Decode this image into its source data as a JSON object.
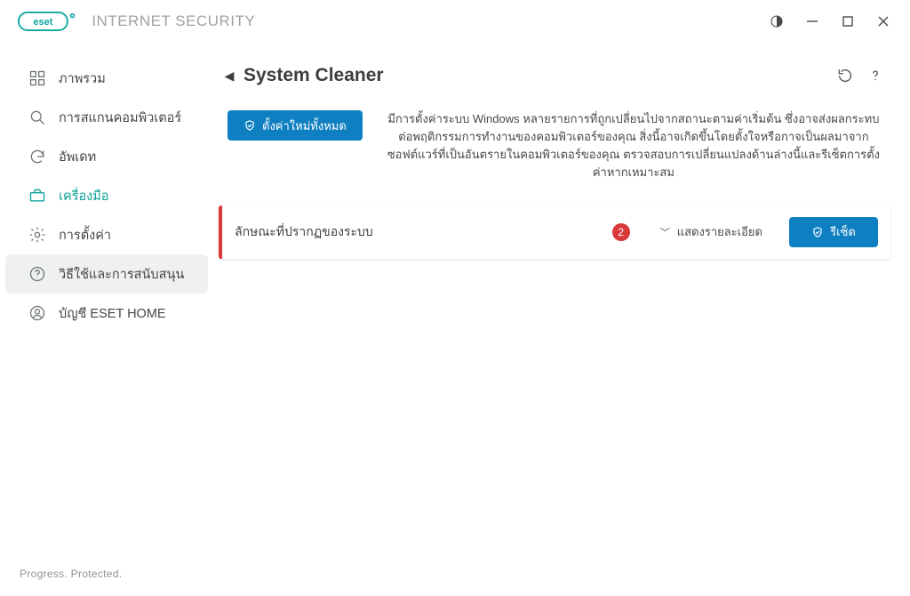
{
  "brand": {
    "badge_text": "eset",
    "product": "INTERNET SECURITY"
  },
  "sidebar": {
    "items": [
      {
        "label": "ภาพรวม"
      },
      {
        "label": "การสแกนคอมพิวเตอร์"
      },
      {
        "label": "อัพเดท"
      },
      {
        "label": "เครื่องมือ"
      },
      {
        "label": "การตั้งค่า"
      },
      {
        "label": "วิธีใช้และการสนับสนุน"
      },
      {
        "label": "บัญชี ESET HOME"
      }
    ],
    "footer": "Progress. Protected."
  },
  "page": {
    "title": "System Cleaner",
    "restore_all": "ตั้งค่าใหม่ทั้งหมด",
    "intro": "มีการตั้งค่าระบบ Windows หลายรายการที่ถูกเปลี่ยนไปจากสถานะตามค่าเริ่มต้น ซึ่งอาจส่งผลกระทบต่อพฤติกรรมการทำงานของคอมพิวเตอร์ของคุณ สิ่งนี้อาจเกิดขึ้นโดยตั้งใจหรือกาจเป็นผลมาจากซอฟต์แวร์ที่เป็นอันตรายในคอมพิวเตอร์ของคุณ ตรวจสอบการเปลี่ยนแปลงด้านล่างนี้และรีเซ็ตการตั้งค่าหากเหมาะสม"
  },
  "issue": {
    "title": "ลักษณะที่ปรากฏของระบบ",
    "count": "2",
    "details_label": "แสดงรายละเอียด",
    "reset_label": "รีเซ็ต"
  }
}
